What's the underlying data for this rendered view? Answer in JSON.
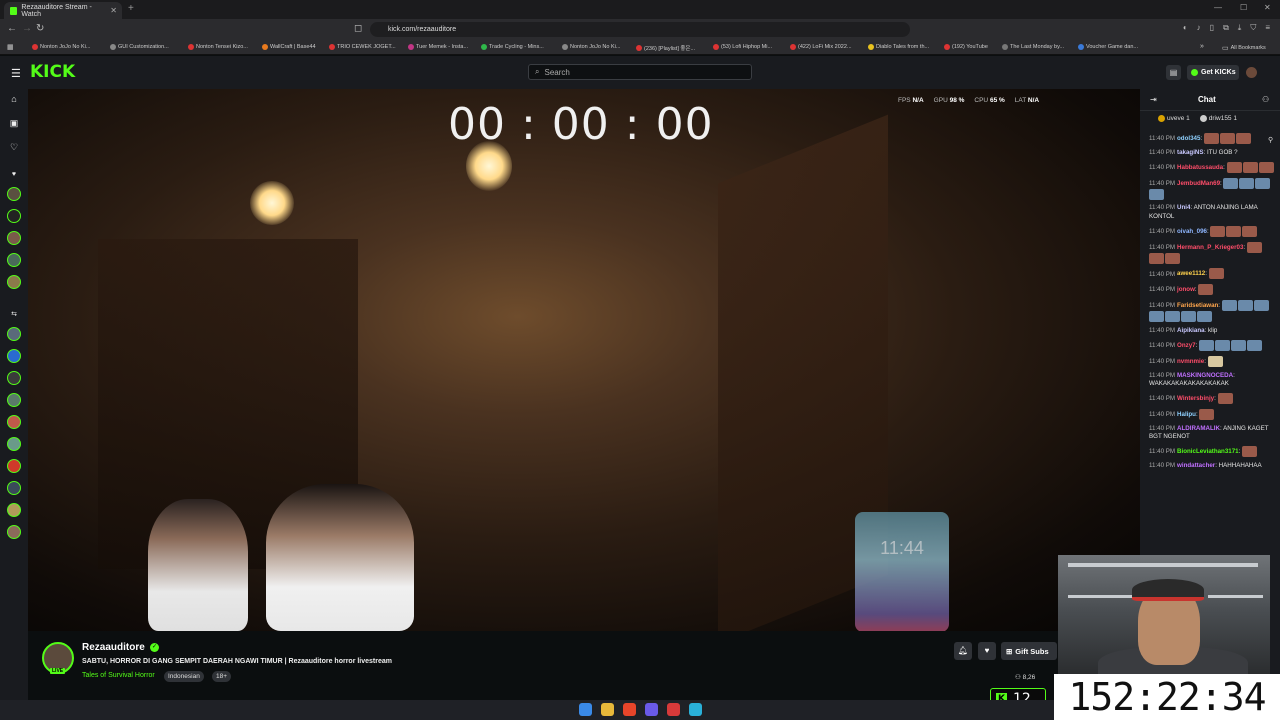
{
  "browser": {
    "tab_title": "Rezaauditore Stream - Watch",
    "url": "kick.com/rezaauditore",
    "bookmarks": [
      "Nonton JoJo No Ki...",
      "GUI Customization...",
      "Nonton Tensei Kizo...",
      "WallCraft | Base44",
      "TRIO CEWEK JOGET...",
      "Tuer Memek - Insta...",
      "Trade Cycling - Mins...",
      "Nonton JoJo No Ki...",
      "(236) [Playlist] 좋은...",
      "(53) Lofi Hiphop Mi...",
      "(422) LoFi Mix 2022...",
      "Diablo Tales from th...",
      "(192) YouTube",
      "The Last Monday by...",
      "Voucher Game dan..."
    ],
    "all_bookmarks": "All Bookmarks"
  },
  "header": {
    "logo": "KICK",
    "search_placeholder": "Search",
    "get_kicks": "Get KICKs"
  },
  "video": {
    "timer": "00 : 00 : 00",
    "stats": {
      "fps_label": "FPS",
      "fps": "N/A",
      "gpu_label": "GPU",
      "gpu": "98 %",
      "cpu_label": "CPU",
      "cpu": "65 %",
      "lat_label": "LAT",
      "lat": "N/A"
    },
    "phone_time": "11:44"
  },
  "stream": {
    "channel": "Rezaauditore",
    "live_badge": "LIVE",
    "title": "SABTU, HORROR DI GANG SEMPIT DAERAH NGAWI TIMUR | Rezaauditore horror livestream",
    "category": "Tales of Survival Horror",
    "tags": [
      "Indonesian",
      "18+"
    ],
    "gift_subs": "Gift Subs",
    "viewers": "8,26"
  },
  "chat": {
    "title": "Chat",
    "gifters": [
      "uveve 1",
      "driw155 1"
    ],
    "messages": [
      {
        "time": "11:40 PM",
        "user": "odol345",
        "color": "#8fd1ff",
        "text": "",
        "emotes": 3
      },
      {
        "time": "11:40 PM",
        "user": "takagiNS",
        "color": "#c9c9ff",
        "text": "ITU GOB ?",
        "emotes": 0
      },
      {
        "time": "11:40 PM",
        "user": "Habbatussauda",
        "color": "#ff4d6a",
        "text": "",
        "emotes": 3
      },
      {
        "time": "11:40 PM",
        "user": "JembudMan69",
        "color": "#ff4d6a",
        "text": "",
        "emotes": 4
      },
      {
        "time": "11:40 PM",
        "user": "Uni4",
        "color": "#c9c9ff",
        "text": "ANTON ANJING LAMA KONTOL",
        "emotes": 0
      },
      {
        "time": "11:40 PM",
        "user": "oivah_096",
        "color": "#8fb7ff",
        "text": "",
        "emotes": 3
      },
      {
        "time": "11:40 PM",
        "user": "Hermann_P_Krieger03",
        "color": "#ff4d6a",
        "text": "",
        "emotes": 3
      },
      {
        "time": "11:40 PM",
        "user": "awee1112",
        "color": "#ffd24d",
        "text": "",
        "emotes": 1
      },
      {
        "time": "11:40 PM",
        "user": "jonow",
        "color": "#ff4d6a",
        "text": "",
        "emotes": 1
      },
      {
        "time": "11:40 PM",
        "user": "Faridsetiawan",
        "color": "#ffa64d",
        "text": "",
        "emotes": 7
      },
      {
        "time": "11:40 PM",
        "user": "Aipikiana",
        "color": "#c9c9ff",
        "text": "klip",
        "emotes": 0
      },
      {
        "time": "11:40 PM",
        "user": "Onzy7",
        "color": "#ff4d6a",
        "text": "",
        "emotes": 4
      },
      {
        "time": "11:40 PM",
        "user": "nvmnmie",
        "color": "#ff4d6a",
        "text": "",
        "emotes": 1
      },
      {
        "time": "11:40 PM",
        "user": "MASKINGNOCEDA",
        "color": "#c070ff",
        "text": "WAKAKAKAKAKAKAKAKAK",
        "emotes": 0
      },
      {
        "time": "11:40 PM",
        "user": "Wintersbinjy",
        "color": "#ff4d6a",
        "text": "",
        "emotes": 1
      },
      {
        "time": "11:40 PM",
        "user": "Halipu",
        "color": "#8fd1ff",
        "text": "",
        "emotes": 1
      },
      {
        "time": "11:40 PM",
        "user": "ALDIRAMALIK",
        "color": "#c070ff",
        "text": "ANJING KAGET BGT NGENOT",
        "emotes": 0
      },
      {
        "time": "11:40 PM",
        "user": "BionicLeviathan3171",
        "color": "#53fc18",
        "text": "",
        "emotes": 1
      },
      {
        "time": "11:40 PM",
        "user": "windattacher",
        "color": "#c070ff",
        "text": "HAHHAHAHAA",
        "emotes": 0
      }
    ]
  },
  "overlay": {
    "kick_counter": "12",
    "big_clock": "152:22:34"
  },
  "colors": {
    "accent": "#53fc18",
    "background": "#0b0e0f",
    "panel": "#191b1f"
  }
}
